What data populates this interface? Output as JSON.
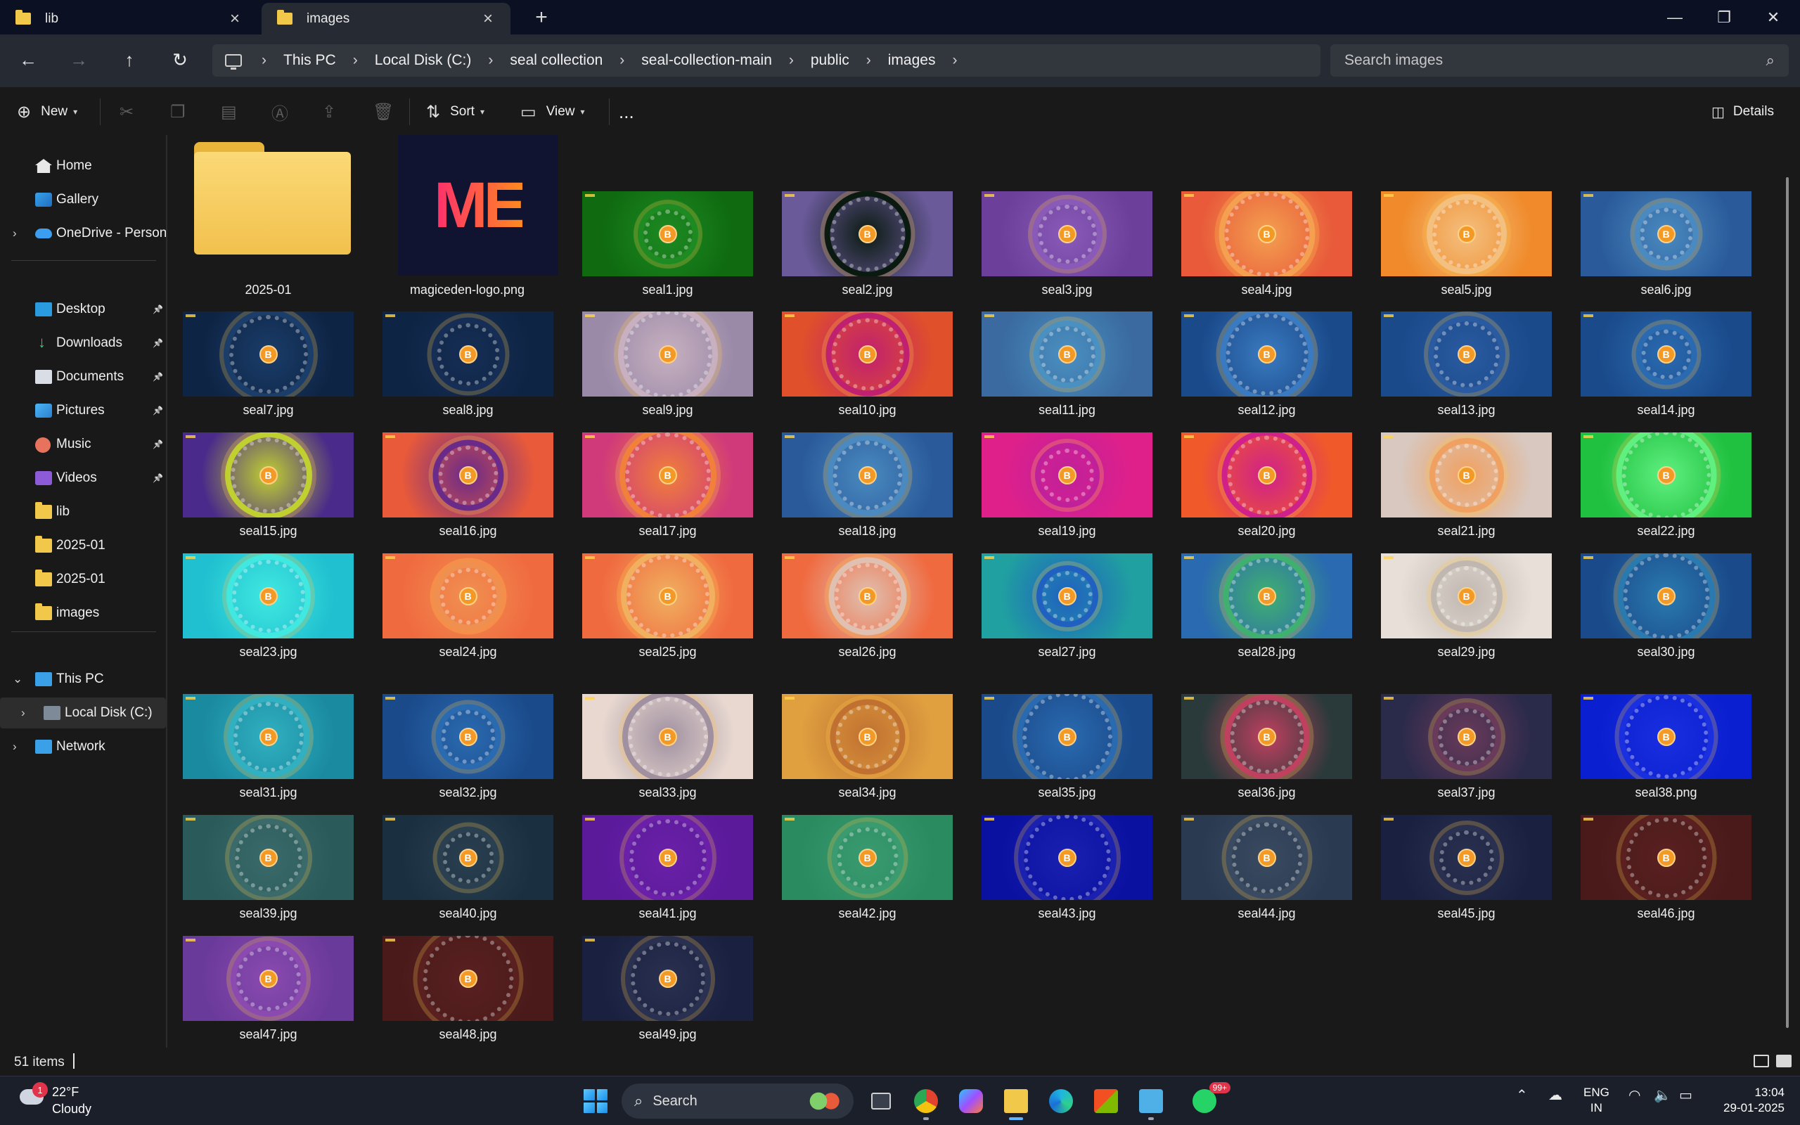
{
  "tabs": [
    {
      "label": "lib",
      "icon": "folder-icon"
    },
    {
      "label": "images",
      "icon": "folder-icon"
    }
  ],
  "breadcrumb": [
    "This PC",
    "Local Disk (C:)",
    "seal collection",
    "seal-collection-main",
    "public",
    "images"
  ],
  "search": {
    "placeholder": "Search images"
  },
  "toolbar": {
    "new_label": "New",
    "sort_label": "Sort",
    "view_label": "View",
    "more_label": "...",
    "details_label": "Details"
  },
  "sidebar": {
    "items": [
      {
        "label": "Home",
        "icon": "home-icon"
      },
      {
        "label": "Gallery",
        "icon": "gallery-icon"
      },
      {
        "label": "OneDrive - Persona",
        "icon": "cloud-icon"
      },
      {
        "label": "Desktop",
        "icon": "desktop-icon"
      },
      {
        "label": "Downloads",
        "icon": "download-icon"
      },
      {
        "label": "Documents",
        "icon": "documents-icon"
      },
      {
        "label": "Pictures",
        "icon": "pictures-icon"
      },
      {
        "label": "Music",
        "icon": "music-icon"
      },
      {
        "label": "Videos",
        "icon": "videos-icon"
      },
      {
        "label": "lib",
        "icon": "folder-icon"
      },
      {
        "label": "2025-01",
        "icon": "folder-icon"
      },
      {
        "label": "2025-01",
        "icon": "folder-icon"
      },
      {
        "label": "images",
        "icon": "folder-icon"
      },
      {
        "label": "This PC",
        "icon": "computer-icon"
      },
      {
        "label": "Local Disk (C:)",
        "icon": "disk-icon"
      },
      {
        "label": "Network",
        "icon": "network-icon"
      }
    ]
  },
  "files": [
    "2025-01",
    "magiceden-logo.png",
    "seal1.jpg",
    "seal2.jpg",
    "seal3.jpg",
    "seal4.jpg",
    "seal5.jpg",
    "seal6.jpg",
    "seal7.jpg",
    "seal8.jpg",
    "seal9.jpg",
    "seal10.jpg",
    "seal11.jpg",
    "seal12.jpg",
    "seal13.jpg",
    "seal14.jpg",
    "seal15.jpg",
    "seal16.jpg",
    "seal17.jpg",
    "seal18.jpg",
    "seal19.jpg",
    "seal20.jpg",
    "seal21.jpg",
    "seal22.jpg",
    "seal23.jpg",
    "seal24.jpg",
    "seal25.jpg",
    "seal26.jpg",
    "seal27.jpg",
    "seal28.jpg",
    "seal29.jpg",
    "seal30.jpg",
    "seal31.jpg",
    "seal32.jpg",
    "seal33.jpg",
    "seal34.jpg",
    "seal35.jpg",
    "seal36.jpg",
    "seal37.jpg",
    "seal38.png",
    "seal39.jpg",
    "seal40.jpg",
    "seal41.jpg",
    "seal42.jpg",
    "seal43.jpg",
    "seal44.jpg",
    "seal45.jpg",
    "seal46.jpg",
    "seal47.jpg",
    "seal48.jpg",
    "seal49.jpg"
  ],
  "logo_text": "ME",
  "thumb_colors": [
    [
      "#0f6a10",
      "#1d8a22"
    ],
    [
      "#6a5a9a",
      "#0a1a10"
    ],
    [
      "#6b3f9a",
      "#8a5ab8"
    ],
    [
      "#e85a3a",
      "#f4a050"
    ],
    [
      "#f08a2a",
      "#f4c080"
    ],
    [
      "#2a5a9a",
      "#4a8ac0"
    ],
    [
      "#0e2444",
      "#1a3d6a"
    ],
    [
      "#0e2444",
      "#162e55"
    ],
    [
      "#9a8aa8",
      "#c8b0c0"
    ],
    [
      "#e0502a",
      "#c02070"
    ],
    [
      "#3a6aa0",
      "#4a90c0"
    ],
    [
      "#1a4a8a",
      "#3a7ac0"
    ],
    [
      "#1a4a8a",
      "#2a5aa0"
    ],
    [
      "#1a4a8a",
      "#2a6ab0"
    ],
    [
      "#4a2a8a",
      "#c0d030"
    ],
    [
      "#e85a3a",
      "#6a2a8a"
    ],
    [
      "#d03a7a",
      "#f0803a"
    ],
    [
      "#2a5a9a",
      "#4a8ac0"
    ],
    [
      "#e0208a",
      "#c0209a"
    ],
    [
      "#f05a2a",
      "#d0208a"
    ],
    [
      "#d8c8c0",
      "#f0a060"
    ],
    [
      "#20c040",
      "#60f080"
    ],
    [
      "#20c0d0",
      "#40e8e0"
    ],
    [
      "#f06a40",
      "#f09050"
    ],
    [
      "#f06a40",
      "#f0b060"
    ],
    [
      "#f06a40",
      "#e0c0b0"
    ],
    [
      "#20a0a0",
      "#2060c0"
    ],
    [
      "#2a6ab0",
      "#40b070"
    ],
    [
      "#e8e0d8",
      "#c0b8b0"
    ],
    [
      "#1a4a8a",
      "#2a7ab0"
    ],
    [
      "#1a8aa0",
      "#30b0c0"
    ],
    [
      "#1a4a8a",
      "#2a6ab0"
    ],
    [
      "#e8d8d0",
      "#a090a0"
    ],
    [
      "#e0a040",
      "#c07030"
    ],
    [
      "#1a4a8a",
      "#2a6ab0"
    ],
    [
      "#2a3a3a",
      "#c04060"
    ],
    [
      "#2a2a4a",
      "#6a3a5a"
    ],
    [
      "#0a20d0",
      "#1a30e0"
    ],
    [
      "#2a5a5a",
      "#3a6a6a"
    ],
    [
      "#1a3040",
      "#2a4050"
    ],
    [
      "#5a1a9a",
      "#6a20a8"
    ],
    [
      "#2a8a60",
      "#3a9a70"
    ],
    [
      "#0a10a0",
      "#1a20b0"
    ],
    [
      "#2a3a50",
      "#3a4a60"
    ],
    [
      "#1a2040",
      "#2a3050"
    ],
    [
      "#4a1a1a",
      "#5a2020"
    ],
    [
      "#6a3a9a",
      "#8a4ab0"
    ],
    [
      "#4a1a1a",
      "#5a2020"
    ],
    [
      "#1a2040",
      "#2a3050"
    ]
  ],
  "status": {
    "item_count": "51 items"
  },
  "weather": {
    "temp": "22°F",
    "condition": "Cloudy",
    "badge": "1"
  },
  "taskbar": {
    "search_label": "Search",
    "whatsapp_badge": "99+"
  },
  "tray": {
    "lang": "ENG",
    "region": "IN",
    "time": "13:04",
    "date": "29-01-2025"
  }
}
